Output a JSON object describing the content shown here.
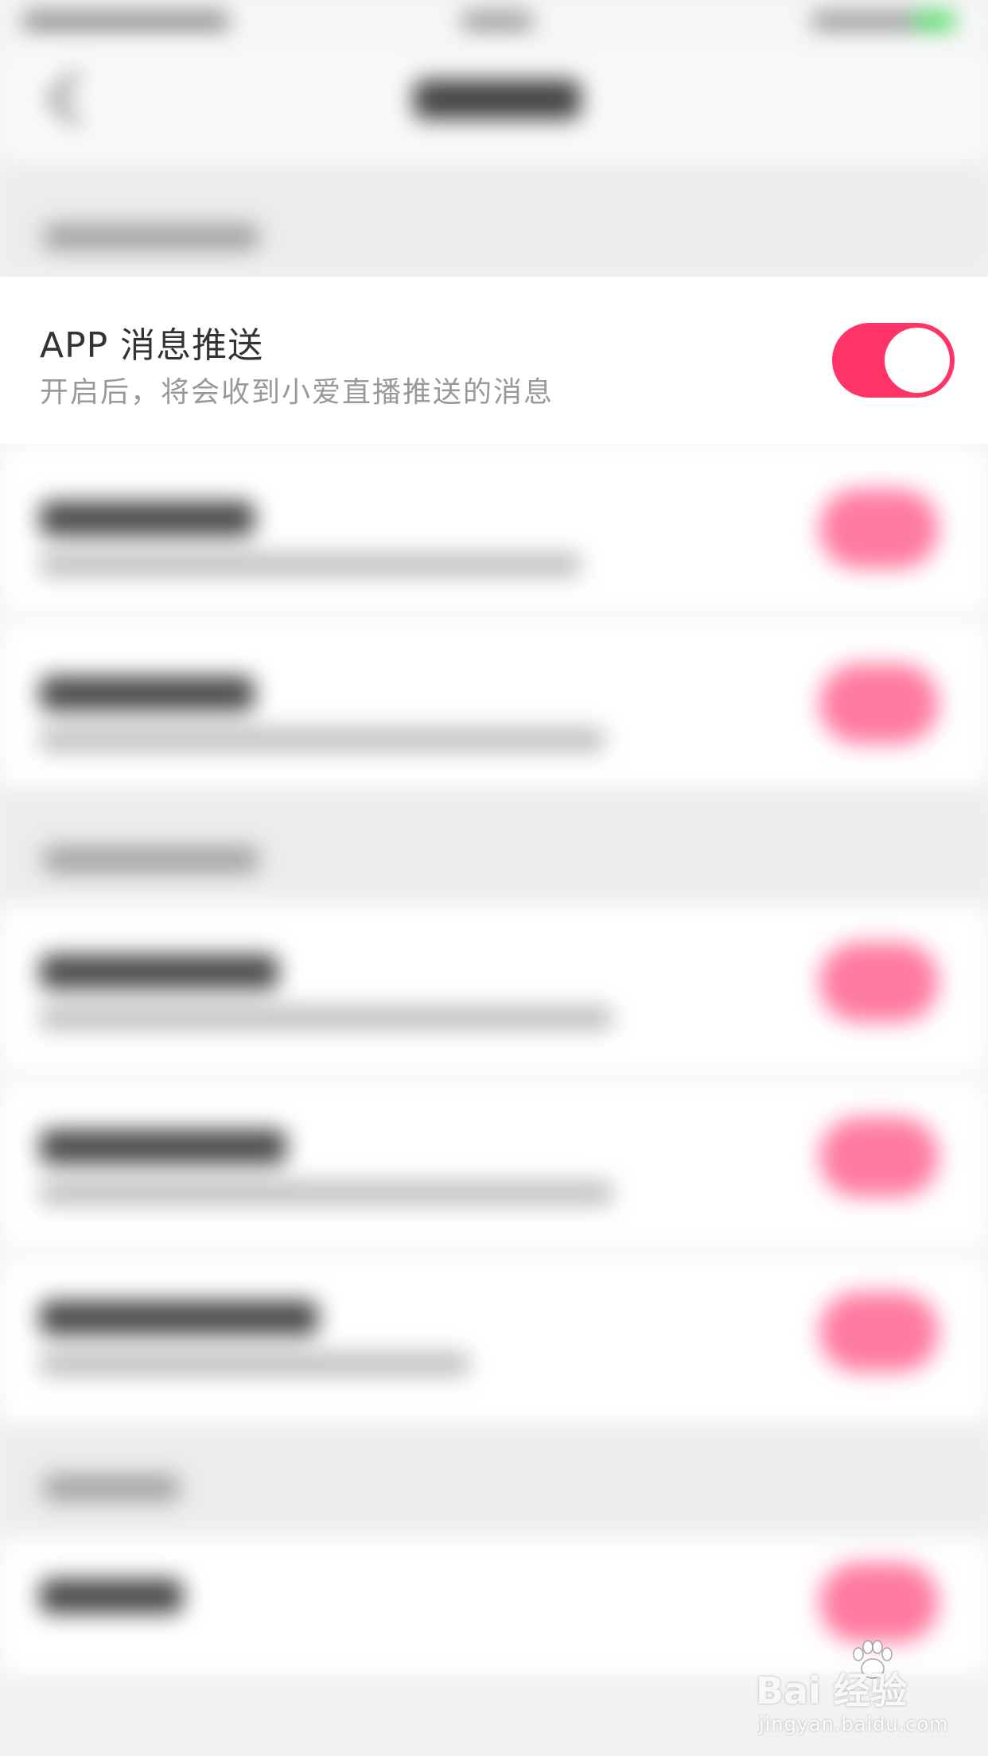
{
  "focus_row": {
    "title": "APP 消息推送",
    "subtitle": "开启后，将会收到小爱直播推送的消息",
    "toggle_on": true
  },
  "colors": {
    "accent": "#ff3366",
    "background": "#f2f2f2"
  },
  "watermark": {
    "logo_text": "Bai  经验",
    "url": "jingyan.baidu.com"
  }
}
